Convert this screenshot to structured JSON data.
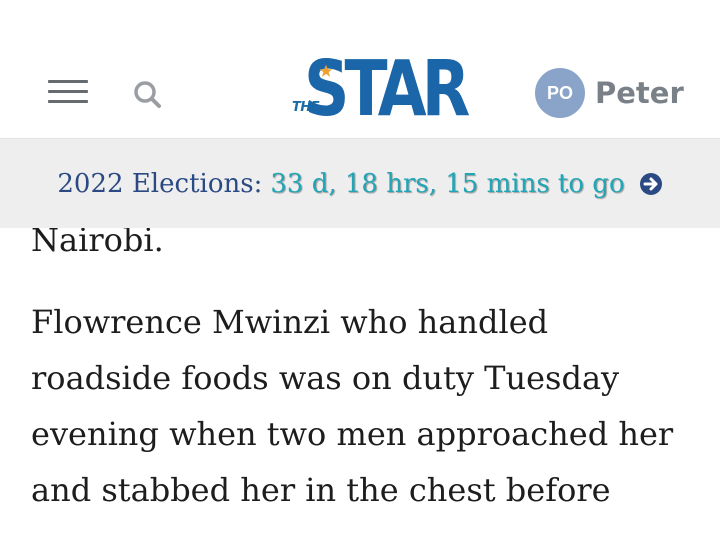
{
  "header": {
    "logo_prefix": "THE",
    "logo_text": "STAR",
    "user_initials": "PO",
    "user_name": "Peter"
  },
  "countdown": {
    "label": "2022 Elections:",
    "time_remaining": "33 d, 18 hrs, 15 mins to go"
  },
  "article": {
    "paragraph_1_tail": "Nairobi.",
    "paragraph_2": "Flowrence Mwinzi who handled roadside foods was on duty Tuesday evening when two men approached her and stabbed her in the chest before"
  },
  "colors": {
    "brand_blue": "#1a66a8",
    "countdown_label": "#2b4a83",
    "countdown_accent": "#20a6b6",
    "avatar_bg": "#8aa3c9"
  }
}
